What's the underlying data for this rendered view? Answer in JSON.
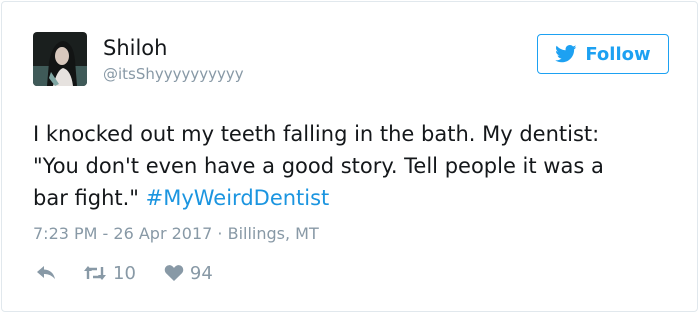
{
  "user": {
    "display_name": "Shiloh",
    "handle": "@itsShyyyyyyyyyy"
  },
  "follow_button": {
    "label": "Follow",
    "icon": "twitter-bird-icon",
    "color": "#1da1f2"
  },
  "tweet": {
    "text": "I knocked out my teeth falling in the bath. My dentist: \"You don't even have a good story. Tell people it was a bar fight.\" ",
    "hashtag": "#MyWeirdDentist",
    "hashtag_color": "#1b95e0",
    "meta": "7:23 PM - 26 Apr 2017 · Billings, MT"
  },
  "actions": {
    "reply_icon": "reply-icon",
    "retweet_icon": "retweet-icon",
    "retweet_count": "10",
    "like_icon": "heart-icon",
    "like_count": "94"
  }
}
